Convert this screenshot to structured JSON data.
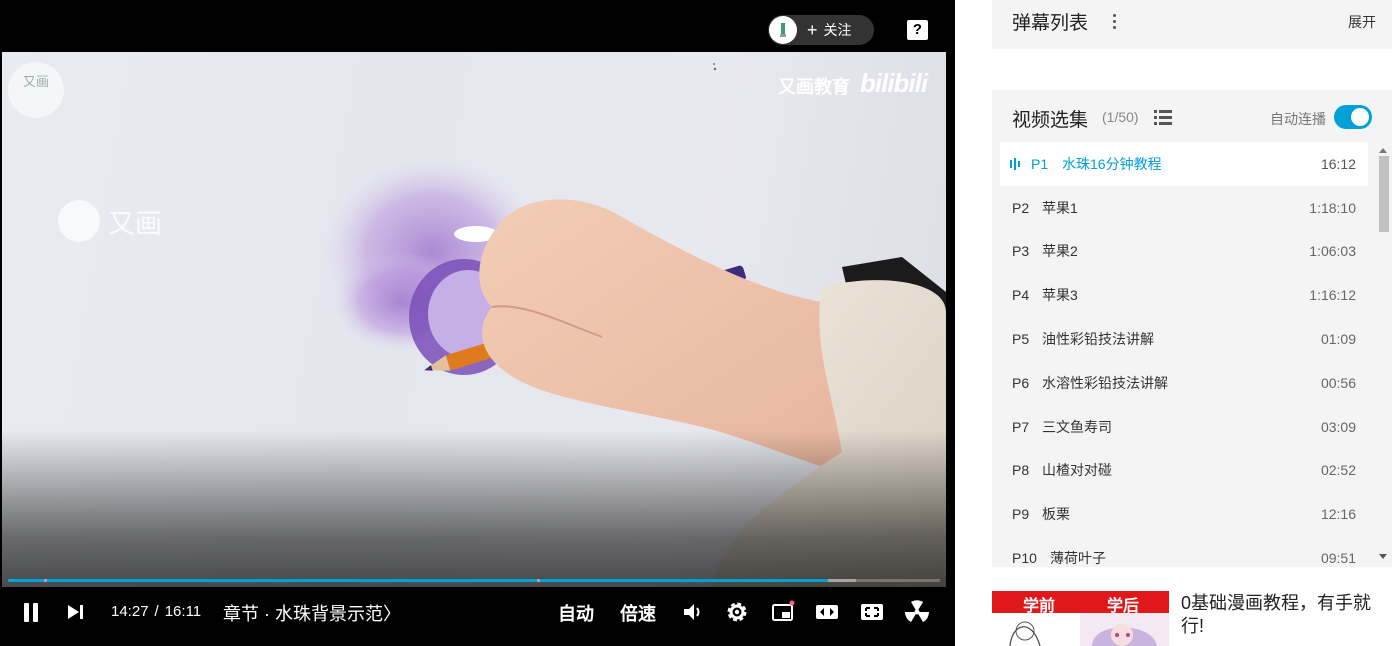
{
  "player": {
    "follow_button": "关注",
    "help_icon": "?",
    "watermark": {
      "brand": "又画教育",
      "site": "bilibili",
      "center_text": "又画",
      "logo_text": "又画"
    },
    "progress": {
      "played_fraction": 0.88,
      "buffered_fraction": 0.91
    },
    "time_current": "14:27",
    "time_separator": "/",
    "time_total": "16:11",
    "chapter": "章节 · 水珠背景示范",
    "chapter_arrow": "〉",
    "auto_label": "自动",
    "speed_label": "倍速",
    "icons": [
      "pause-icon",
      "next-icon",
      "volume-icon",
      "settings-icon",
      "pip-icon",
      "wide-mode-icon",
      "fullscreen-icon",
      "radiation-icon"
    ]
  },
  "danmaku": {
    "title": "弹幕列表",
    "expand": "展开"
  },
  "episodes": {
    "title": "视频选集",
    "count": "(1/50)",
    "autoplay_label": "自动连播",
    "autoplay_on": true,
    "accent_color": "#00a1d6",
    "items": [
      {
        "p": "P1",
        "name": "水珠16分钟教程",
        "duration": "16:12",
        "active": true
      },
      {
        "p": "P2",
        "name": "苹果1",
        "duration": "1:18:10"
      },
      {
        "p": "P3",
        "name": "苹果2",
        "duration": "1:06:03"
      },
      {
        "p": "P4",
        "name": "苹果3",
        "duration": "1:16:12"
      },
      {
        "p": "P5",
        "name": "油性彩铅技法讲解",
        "duration": "01:09"
      },
      {
        "p": "P6",
        "name": "水溶性彩铅技法讲解",
        "duration": "00:56"
      },
      {
        "p": "P7",
        "name": "三文鱼寿司",
        "duration": "03:09"
      },
      {
        "p": "P8",
        "name": "山楂对对碰",
        "duration": "02:52"
      },
      {
        "p": "P9",
        "name": "板栗",
        "duration": "12:16"
      },
      {
        "p": "P10",
        "name": "薄荷叶子",
        "duration": "09:51"
      }
    ]
  },
  "recommend": {
    "badge_left": "学前",
    "badge_right": "学后",
    "title": "0基础漫画教程，有手就行!"
  }
}
